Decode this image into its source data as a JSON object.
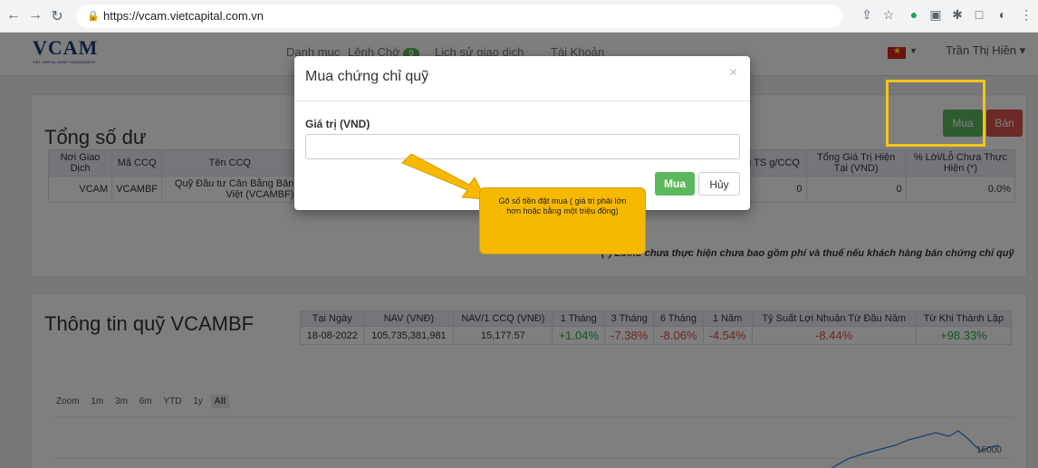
{
  "browser": {
    "url": "https://vcam.vietcapital.com.vn"
  },
  "header": {
    "logo_text": "VCAM",
    "logo_subtitle": "VIET CAPITAL ASSET MANAGEMENT",
    "nav": [
      "Danh mục",
      "Lệnh Chờ",
      "Lịch sử giao dịch",
      "Tài Khoản"
    ],
    "pending_count": "0",
    "user_name": "Trần Thị Hiền"
  },
  "balance": {
    "title": "Tổng số dư",
    "buy_label": "Mua",
    "sell_label": "Bán",
    "columns": [
      "Nơi Giao Dịch",
      "Mã CCQ",
      "Tên CCQ",
      "Giá Trị TS g/CCQ",
      "Tổng Giá Trị Hiện Tại (VND)",
      "% Lời/Lỗ Chưa Thực Hiện (*)"
    ],
    "row": {
      "place": "VCAM",
      "code": "VCAMBF",
      "name": "Quỹ Đầu tư Cân Bằng Bản Việt (VCAMBF)",
      "nav_per": "0",
      "total": "0",
      "pnl": "0.0%"
    },
    "note": "(*) Lời/lỗ chưa thực hiện chưa bao gồm phí và thuế nếu khách hàng bán chứng chỉ quỹ"
  },
  "fund": {
    "title": "Thông tin quỹ VCAMBF",
    "columns": [
      "Tại Ngày",
      "NAV (VNĐ)",
      "NAV/1 CCQ (VNĐ)",
      "1 Tháng",
      "3 Tháng",
      "6 Tháng",
      "1 Năm",
      "Tỷ Suất Lợi Nhuận Từ Đầu Năm",
      "Từ Khi Thành Lập"
    ],
    "values": [
      "18-08-2022",
      "105,735,381,981",
      "15,177.57",
      "+1.04%",
      "-7.38%",
      "-8.06%",
      "-4.54%",
      "-8.44%",
      "+98.33%"
    ],
    "zoom_label": "Zoom",
    "zoom_options": [
      "1m",
      "3m",
      "6m",
      "YTD",
      "1y",
      "All"
    ],
    "chart_tick": "15000"
  },
  "modal": {
    "title": "Mua chứng chỉ quỹ",
    "close": "×",
    "field_label": "Giá trị (VND)",
    "field_value": "",
    "confirm": "Mua",
    "cancel": "Hủy"
  },
  "callout": {
    "text": "Gõ số tiền đặt mua ( giá trị phải lớn hơn hoặc bằng một triệu đồng)"
  },
  "colors": {
    "accent_green": "#5cb85c",
    "danger_red": "#d9534f",
    "highlight_yellow": "#f5c518"
  }
}
